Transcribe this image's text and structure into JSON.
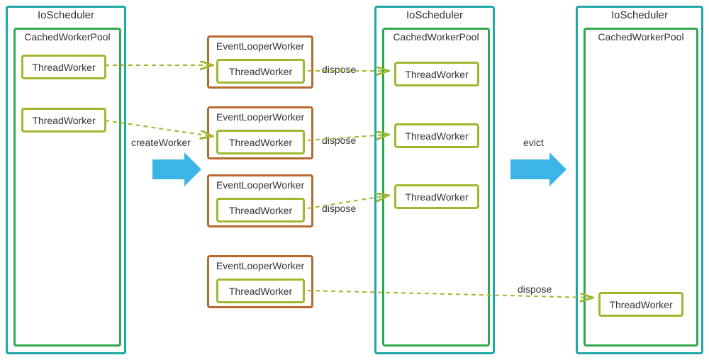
{
  "labels": {
    "io_scheduler": "IoScheduler",
    "cached_pool": "CachedWorkerPool",
    "thread_worker": "ThreadWorker",
    "event_looper": "EventLooperWorker",
    "create_worker": "createWorker",
    "dispose": "dispose",
    "evict": "evict"
  },
  "colors": {
    "teal": "#1fa8a8",
    "green": "#2fa84f",
    "olive": "#a0b82f",
    "brown": "#b8692f",
    "blue_arrow": "#3db4e8"
  },
  "diagram": {
    "description": "Lifecycle of IoScheduler workers: CachedWorkerPool holds ThreadWorkers; createWorker wraps them in EventLooperWorker; dispose returns them to pool; evict removes idle workers leaving one.",
    "stages": [
      {
        "name": "initial_pool",
        "thread_workers": 2
      },
      {
        "name": "after_createWorker",
        "event_loopers": 4
      },
      {
        "name": "after_dispose",
        "thread_workers_in_pool": 3
      },
      {
        "name": "after_evict",
        "thread_workers_in_pool": 1
      }
    ]
  }
}
